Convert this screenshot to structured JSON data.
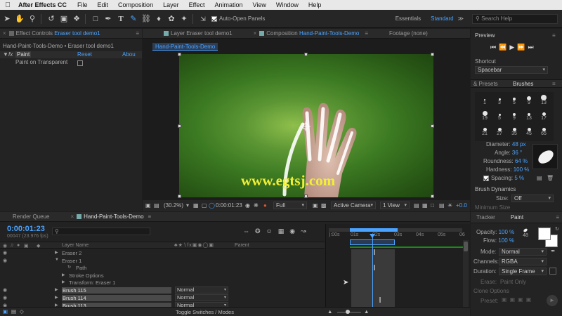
{
  "menubar": {
    "app": "After Effects CC",
    "items": [
      "File",
      "Edit",
      "Composition",
      "Layer",
      "Effect",
      "Animation",
      "View",
      "Window",
      "Help"
    ]
  },
  "toolbar": {
    "auto_open": "Auto-Open Panels",
    "workspaces": [
      "Essentials",
      "Standard"
    ],
    "active_workspace": "Standard",
    "search_placeholder": "Search Help"
  },
  "effect_controls": {
    "tab_prefix": "Effect Controls",
    "tab_layer": "Eraser tool demo1",
    "breadcrumb": "Hand-Paint-Tools-Demo • Eraser tool demo1",
    "effect_name": "Paint",
    "reset": "Reset",
    "about": "Abou",
    "fx": "fx",
    "paint_on_transparent": "Paint on Transparent"
  },
  "comp_panel": {
    "tab_layer": "Layer  Eraser tool demo1",
    "tab_comp_prefix": "Composition",
    "tab_comp_name": "Hand-Paint-Tools-Demo",
    "tab_footage": "Footage  (none)",
    "comp_label": "Hand-Paint-Tools-Demo",
    "watermark": "www.egtsj.com",
    "zoom": "(30.2%)",
    "timecode": "0:00:01:23",
    "resolution": "Full",
    "camera": "Active Camera",
    "views": "1 View",
    "offset": "+0.0"
  },
  "preview": {
    "title": "Preview",
    "shortcut_label": "Shortcut",
    "shortcut_value": "Spacebar"
  },
  "brushes": {
    "tab_presets": "& Presets",
    "tab_brushes": "Brushes",
    "grid": [
      {
        "n": "1",
        "d": 2
      },
      {
        "n": "3",
        "d": 3
      },
      {
        "n": "5",
        "d": 4
      },
      {
        "n": "9",
        "d": 6
      },
      {
        "n": "13",
        "d": 8
      },
      {
        "n": "19",
        "d": 7
      },
      {
        "n": "5",
        "d": 3
      },
      {
        "n": "9",
        "d": 4
      },
      {
        "n": "13",
        "d": 4
      },
      {
        "n": "17",
        "d": 5
      },
      {
        "n": "21",
        "d": 5
      },
      {
        "n": "27",
        "d": 5
      },
      {
        "n": "35",
        "d": 5
      },
      {
        "n": "45",
        "d": 5
      },
      {
        "n": "65",
        "d": 5
      }
    ],
    "diameter_label": "Diameter:",
    "diameter_value": "48 px",
    "angle_label": "Angle:",
    "angle_value": "36 °",
    "roundness_label": "Roundness:",
    "roundness_value": "64 %",
    "hardness_label": "Hardness:",
    "hardness_value": "100 %",
    "spacing_label": "Spacing:",
    "spacing_value": "5 %",
    "dynamics": "Brush Dynamics",
    "size_label": "Size:",
    "size_value": "Off",
    "min_size": "Minimum Size"
  },
  "timeline": {
    "tab_render": "Render Queue",
    "tab_comp": "Hand-Paint-Tools-Demo",
    "timecode": "0:00:01:23",
    "frames": "00047 (23.976 fps)",
    "search_placeholder": "",
    "col_layer": "Layer Name",
    "col_parent": "Parent",
    "ruler": [
      "):00s",
      "01s",
      "02s",
      "03s",
      "04s",
      "05s",
      "06"
    ],
    "rows": [
      {
        "name": "Eraser 2",
        "indent": 0,
        "tri": "▶"
      },
      {
        "name": "Eraser 1",
        "indent": 0,
        "tri": "▼"
      },
      {
        "name": "Path",
        "indent": 2,
        "tri": ""
      },
      {
        "name": "Stroke Options",
        "indent": 1,
        "tri": "▶"
      },
      {
        "name": "Transform: Eraser 1",
        "indent": 1,
        "tri": "▶"
      }
    ],
    "layers": [
      {
        "name": "Brush 115",
        "mode": "Normal"
      },
      {
        "name": "Brush 114",
        "mode": "Normal"
      },
      {
        "name": "Brush 113",
        "mode": "Normal"
      }
    ],
    "toggle": "Toggle Switches / Modes"
  },
  "paint": {
    "tab_tracker": "Tracker",
    "tab_paint": "Paint",
    "opacity_label": "Opacity:",
    "opacity_value": "100 %",
    "flow_label": "Flow:",
    "flow_value": "100 %",
    "brush_size": "48",
    "mode_label": "Mode:",
    "mode_value": "Normal",
    "channels_label": "Channels:",
    "channels_value": "RGBA",
    "duration_label": "Duration:",
    "duration_value": "Single Frame",
    "erase_label": "Erase:",
    "erase_value": "Paint Only",
    "clone_options": "Clone Options",
    "preset_label": "Preset:"
  }
}
